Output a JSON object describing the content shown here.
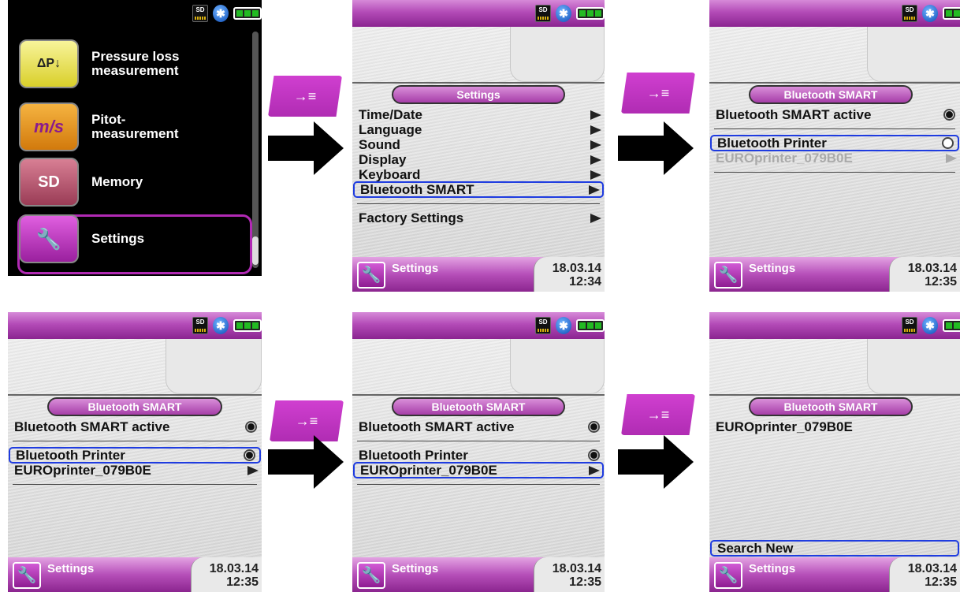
{
  "status_icons": [
    "sd-card-icon",
    "bluetooth-icon",
    "battery-icon"
  ],
  "sd_label": "SD",
  "bt_glyph": "✱",
  "main_menu": {
    "items": [
      {
        "icon_text": "ΔP↓",
        "label": "Pressure loss\nmeasurement"
      },
      {
        "icon_text": "m/s",
        "label": "Pitot-\nmeasurement"
      },
      {
        "icon_text": "SD",
        "label": "Memory"
      },
      {
        "icon_text": "🔧",
        "label": "Settings"
      }
    ],
    "selected_index": 3
  },
  "enter_glyph": "→≡",
  "settings_screen": {
    "title": "Settings",
    "items": [
      "Time/Date",
      "Language",
      "Sound",
      "Display",
      "Keyboard",
      "Bluetooth SMART"
    ],
    "selected": "Bluetooth SMART",
    "factory": "Factory Settings",
    "footer_label": "Settings",
    "date": "18.03.14",
    "time": "12:34"
  },
  "bt_screens": [
    {
      "title": "Bluetooth SMART",
      "active_label": "Bluetooth SMART active",
      "printer_label": "Bluetooth Printer",
      "printer_name": "EUROprinter_079B0E",
      "footer_label": "Settings",
      "date": "18.03.14",
      "time": "12:35"
    },
    {
      "title": "Bluetooth SMART",
      "active_label": "Bluetooth SMART active",
      "printer_label": "Bluetooth Printer",
      "printer_name": "EUROprinter_079B0E",
      "footer_label": "Settings",
      "date": "18.03.14",
      "time": "12:35"
    },
    {
      "title": "Bluetooth SMART",
      "active_label": "Bluetooth SMART active",
      "printer_label": "Bluetooth Printer",
      "printer_name": "EUROprinter_079B0E",
      "footer_label": "Settings",
      "date": "18.03.14",
      "time": "12:35"
    }
  ],
  "search_screen": {
    "title": "Bluetooth SMART",
    "printer_name": "EUROprinter_079B0E",
    "search_label": "Search New",
    "footer_label": "Settings",
    "date": "18.03.14",
    "time": "12:35"
  },
  "footer_icon": "🔧"
}
